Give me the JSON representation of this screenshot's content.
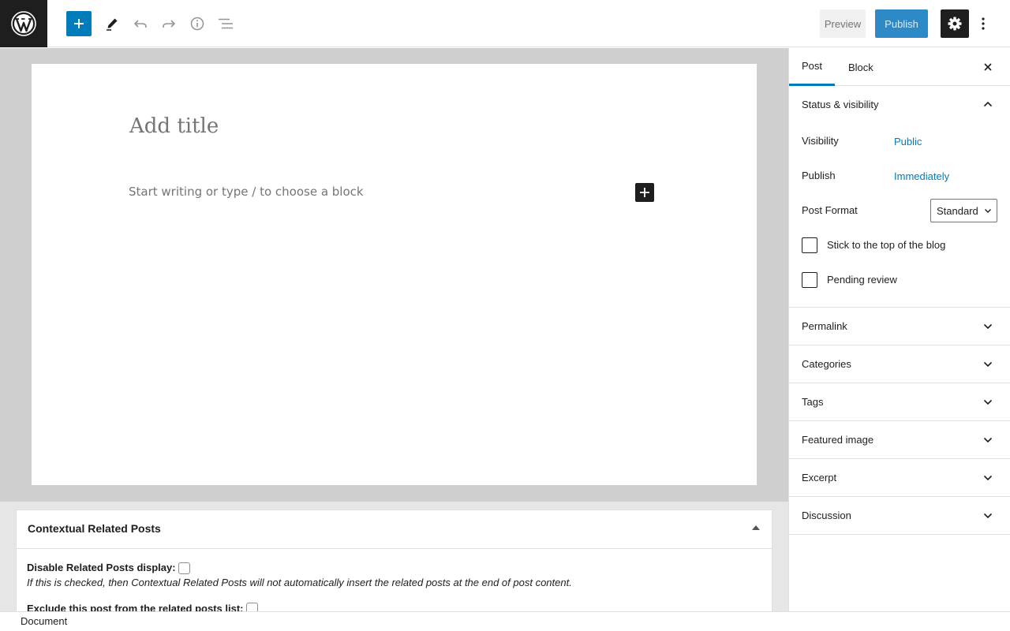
{
  "toolbar": {
    "preview_label": "Preview",
    "publish_label": "Publish",
    "icons": [
      "wordpress-logo",
      "plus-icon",
      "pencil-icon",
      "undo-icon",
      "redo-icon",
      "info-icon",
      "list-view-icon",
      "gear-icon",
      "more-vertical-icon"
    ]
  },
  "editor": {
    "title_placeholder": "Add title",
    "body_placeholder": "Start writing or type / to choose a block"
  },
  "meta_box": {
    "title": "Contextual Related Posts",
    "disable_label": "Disable Related Posts display:",
    "disable_desc": "If this is checked, then Contextual Related Posts will not automatically insert the related posts at the end of post content.",
    "exclude_label": "Exclude this post from the related posts list:"
  },
  "sidebar": {
    "tabs": [
      {
        "label": "Post"
      },
      {
        "label": "Block"
      }
    ],
    "status_panel": {
      "title": "Status & visibility",
      "visibility_label": "Visibility",
      "visibility_value": "Public",
      "publish_label": "Publish",
      "publish_value": "Immediately",
      "format_label": "Post Format",
      "format_value": "Standard",
      "sticky_label": "Stick to the top of the blog",
      "pending_label": "Pending review"
    },
    "panels": [
      {
        "title": "Permalink"
      },
      {
        "title": "Categories"
      },
      {
        "title": "Tags"
      },
      {
        "title": "Featured image"
      },
      {
        "title": "Excerpt"
      },
      {
        "title": "Discussion"
      }
    ]
  },
  "footer": {
    "breadcrumb": "Document"
  },
  "colors": {
    "accent": "#007cba",
    "dark": "#1e1e1e",
    "placeholder": "#757575"
  }
}
